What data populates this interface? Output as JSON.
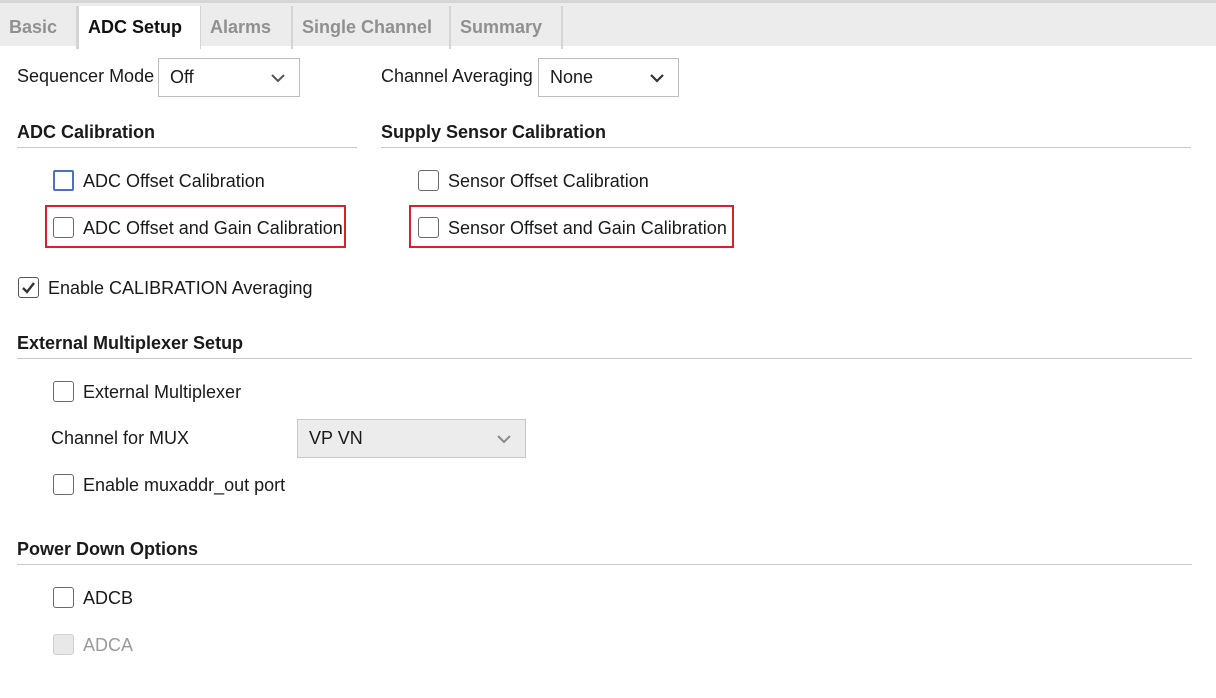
{
  "tabs": [
    {
      "label": "Basic"
    },
    {
      "label": "ADC Setup"
    },
    {
      "label": "Alarms"
    },
    {
      "label": "Single Channel"
    },
    {
      "label": "Summary"
    }
  ],
  "active_tab": "ADC Setup",
  "sequencer": {
    "label": "Sequencer Mode",
    "value": "Off"
  },
  "channel_averaging": {
    "label": "Channel Averaging",
    "value": "None"
  },
  "adc_calibration": {
    "title": "ADC Calibration",
    "offset": {
      "label": "ADC Offset Calibration",
      "checked": false
    },
    "offset_gain": {
      "label": "ADC Offset and Gain Calibration",
      "checked": false
    }
  },
  "supply_sensor_calibration": {
    "title": "Supply Sensor Calibration",
    "offset": {
      "label": "Sensor Offset Calibration",
      "checked": false
    },
    "offset_gain": {
      "label": "Sensor Offset and Gain Calibration",
      "checked": false
    }
  },
  "calibration_averaging": {
    "label": "Enable CALIBRATION Averaging",
    "checked": true
  },
  "external_mux": {
    "title": "External Multiplexer Setup",
    "external": {
      "label": "External Multiplexer",
      "checked": false
    },
    "channel_label": "Channel for MUX",
    "channel_value": "VP VN",
    "muxaddr": {
      "label": "Enable muxaddr_out port",
      "checked": false
    }
  },
  "power_down": {
    "title": "Power Down Options",
    "adcb": {
      "label": "ADCB",
      "checked": false
    },
    "adca": {
      "label": "ADCA",
      "checked": false,
      "disabled": true
    }
  },
  "colors": {
    "highlight": "#d8222b",
    "focus": "#4a72c4"
  }
}
